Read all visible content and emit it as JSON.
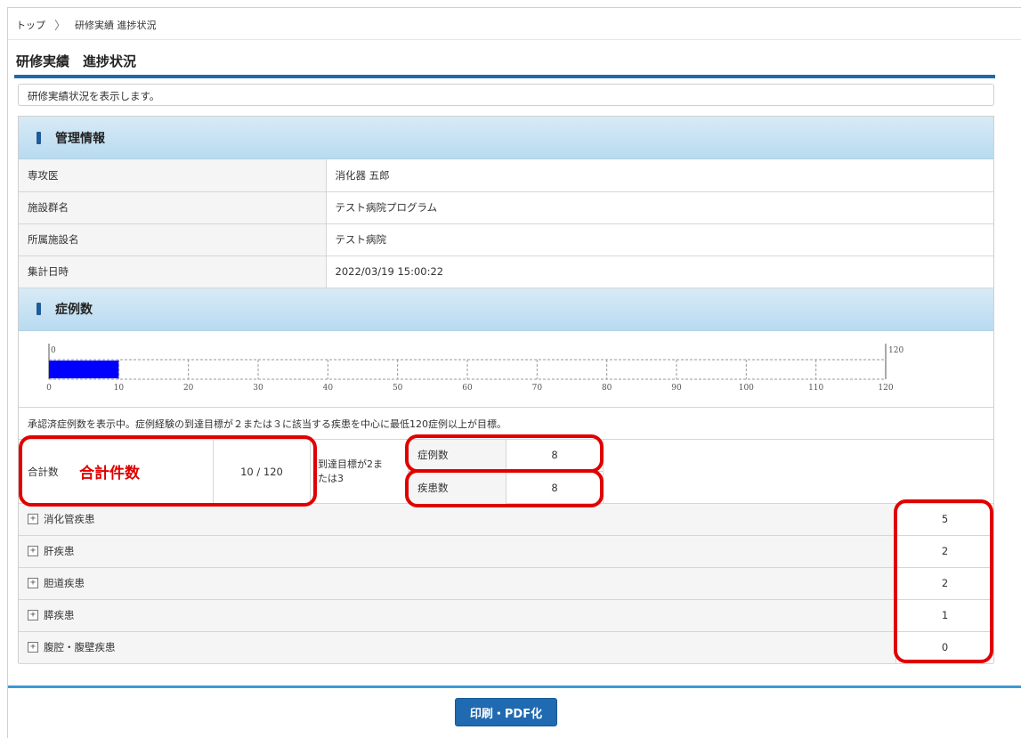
{
  "breadcrumb": {
    "home": "トップ",
    "separator": "〉",
    "current": "研修実績 進捗状況"
  },
  "page_title": "研修実績　進捗状況",
  "description": "研修実績状況を表示します。",
  "management": {
    "heading": "管理情報",
    "rows": [
      {
        "label": "専攻医",
        "value": "消化器 五郎"
      },
      {
        "label": "施設群名",
        "value": "テスト病院プログラム"
      },
      {
        "label": "所属施設名",
        "value": "テスト病院"
      },
      {
        "label": "集計日時",
        "value": "2022/03/19 15:00:22"
      }
    ]
  },
  "cases": {
    "heading": "症例数",
    "note": "承認済症例数を表示中。症例経験の到達目標が２または３に該当する疾患を中心に最低120症例以上が目標。",
    "progress": {
      "value": 10,
      "max": 120,
      "start_label": "0",
      "end_label": "120",
      "ticks": [
        "0",
        "10",
        "20",
        "30",
        "40",
        "50",
        "60",
        "70",
        "80",
        "90",
        "100",
        "110",
        "120"
      ]
    }
  },
  "totals": {
    "label": "合計数",
    "annotation": "合計件数",
    "value": "10 / 120",
    "target_label": "到達目標が2または3",
    "case_label": "症例数",
    "case_value": "8",
    "disease_label": "疾患数",
    "disease_value": "8"
  },
  "diseases": [
    {
      "name": "消化管疾患",
      "count": "5"
    },
    {
      "name": "肝疾患",
      "count": "2"
    },
    {
      "name": "胆道疾患",
      "count": "2"
    },
    {
      "name": "膵疾患",
      "count": "1"
    },
    {
      "name": "腹腔・腹壁疾患",
      "count": "0"
    }
  ],
  "print_button": "印刷・PDF化",
  "colors": {
    "accent": "#1f6aa8",
    "progress_fill": "#0000ff",
    "highlight": "#e00000"
  }
}
